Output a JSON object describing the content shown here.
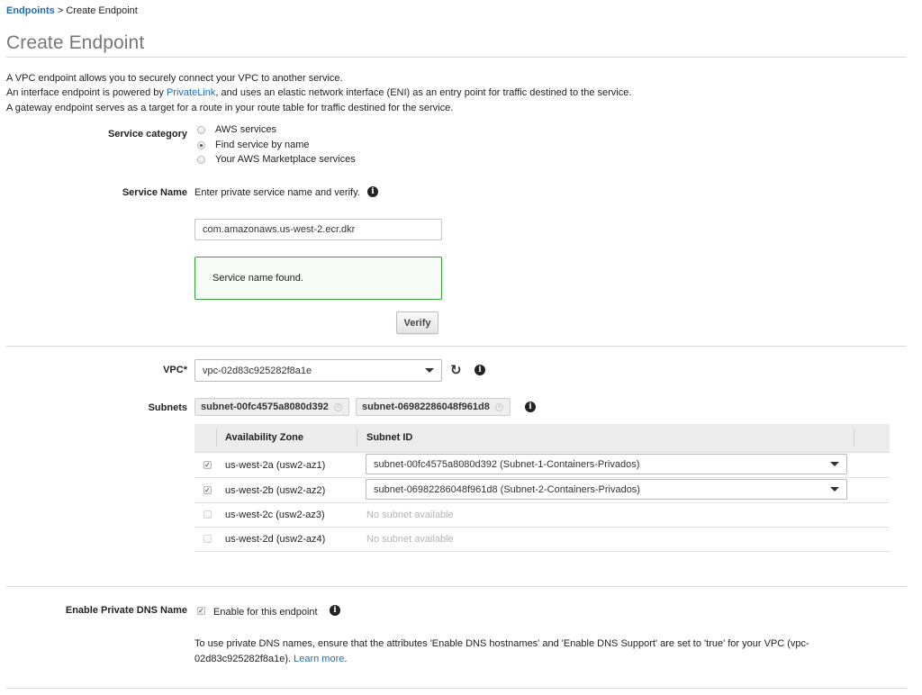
{
  "breadcrumb": {
    "root": "Endpoints",
    "separator": ">",
    "current": "Create Endpoint"
  },
  "page_title": "Create Endpoint",
  "intro": {
    "line1": "A VPC endpoint allows you to securely connect your VPC to another service.",
    "line2_prefix": "An interface endpoint is powered by ",
    "line2_link": "PrivateLink",
    "line2_suffix": ", and uses an elastic network interface (ENI) as an entry point for traffic destined to the service.",
    "line3": "A gateway endpoint serves as a target for a route in your route table for traffic destined for the service."
  },
  "service_category": {
    "label": "Service category",
    "options": [
      {
        "label": "AWS services",
        "selected": false
      },
      {
        "label": "Find service by name",
        "selected": true
      },
      {
        "label": "Your AWS Marketplace services",
        "selected": false
      }
    ]
  },
  "service_name": {
    "label": "Service Name",
    "hint": "Enter private service name and verify.",
    "value": "com.amazonaws.us-west-2.ecr.dkr",
    "status": "Service name found.",
    "verify_label": "Verify"
  },
  "vpc": {
    "label": "VPC*",
    "value": "vpc-02d83c925282f8a1e"
  },
  "subnets": {
    "label": "Subnets",
    "chips": [
      "subnet-00fc4575a8080d392",
      "subnet-06982286048f961d8"
    ],
    "columns": {
      "az": "Availability Zone",
      "subnet": "Subnet ID"
    },
    "rows": [
      {
        "checked": true,
        "zone": "us-west-2a (usw2-az1)",
        "subnet": "subnet-00fc4575a8080d392 (Subnet-1-Containers-Privados)",
        "available": true
      },
      {
        "checked": true,
        "zone": "us-west-2b (usw2-az2)",
        "subnet": "subnet-06982286048f961d8 (Subnet-2-Containers-Privados)",
        "available": true
      },
      {
        "checked": false,
        "zone": "us-west-2c (usw2-az3)",
        "subnet": "No subnet available",
        "available": false
      },
      {
        "checked": false,
        "zone": "us-west-2d (usw2-az4)",
        "subnet": "No subnet available",
        "available": false
      }
    ]
  },
  "private_dns": {
    "label": "Enable Private DNS Name",
    "checkbox_label": "Enable for this endpoint",
    "checked": true,
    "note_line1": "To use private DNS names, ensure that the attributes 'Enable DNS hostnames' and 'Enable DNS Support' are set to 'true' for your VPC (vpc-",
    "note_line2": "02d83c925282f8a1e).",
    "learn_more": "Learn more",
    "note_end": "."
  },
  "icons": {
    "info": "info-icon",
    "refresh": "refresh-icon",
    "caret": "chevron-down-icon",
    "chip_remove": "close-icon"
  },
  "colors": {
    "link": "#1b6fb7",
    "success_border": "#3c9d3c",
    "title": "#777777"
  }
}
